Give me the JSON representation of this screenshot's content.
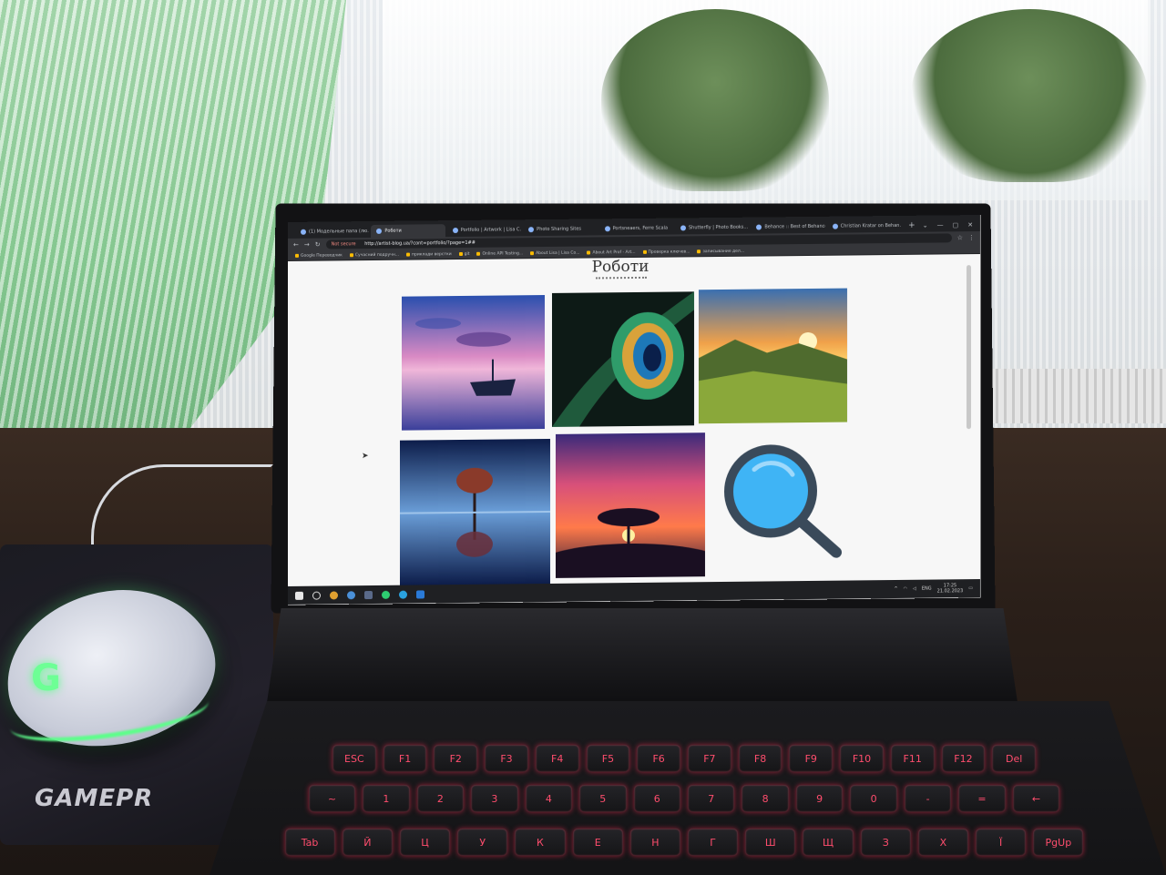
{
  "browser": {
    "tabs": [
      {
        "label": "(1) Модельные папа (лю...",
        "active": false
      },
      {
        "label": "Роботи",
        "active": true
      },
      {
        "label": "Portfolio | Artwork | Lisa C...",
        "active": false
      },
      {
        "label": "Photo Sharing Sites",
        "active": false
      },
      {
        "label": "Portsneaers, Ferre Scala",
        "active": false
      },
      {
        "label": "Shutterfly | Photo Books...",
        "active": false
      },
      {
        "label": "Behance :: Best of Behance",
        "active": false
      },
      {
        "label": "Christian Kratar on Behan...",
        "active": false
      }
    ],
    "new_tab": "+",
    "window_controls": [
      "⌄",
      "—",
      "▢",
      "✕"
    ],
    "address": {
      "security": "Not secure",
      "url": "http://artist-blog.ua/?cont=portfolio/?page=1##"
    },
    "bookmarks": [
      "Google Переводчик",
      "Сучасний подручн...",
      "приклади верстки",
      "git",
      "Online API Testing...",
      "About Lisa | Lisa Co...",
      "About Art Prof - Art...",
      "Проверка ключев...",
      "записывание дел..."
    ]
  },
  "page": {
    "title": "Роботи"
  },
  "taskbar": {
    "lang": "ENG",
    "time": "17:25",
    "date": "21.02.2023"
  },
  "room": {
    "mousepad_brand": "GAMEPR",
    "mouse_logo": "G"
  },
  "colors": {
    "wall": "#1a8a3c",
    "mouse_glow": "#5cff8a",
    "key_backlight": "#ff3a5c",
    "search_icon_lens": "#3fb4f5",
    "search_icon_ring": "#3a4a5a"
  },
  "keyboard_rows": [
    [
      "ESC",
      "F1",
      "F2",
      "F3",
      "F4",
      "F5",
      "F6",
      "F7",
      "F8",
      "F9",
      "F10",
      "F11",
      "F12",
      "Del"
    ],
    [
      "~",
      "1",
      "2",
      "3",
      "4",
      "5",
      "6",
      "7",
      "8",
      "9",
      "0",
      "-",
      "=",
      "←"
    ],
    [
      "Tab",
      "Й",
      "Ц",
      "У",
      "К",
      "Е",
      "Н",
      "Г",
      "Ш",
      "Щ",
      "З",
      "Х",
      "Ї",
      "PgUp"
    ]
  ]
}
